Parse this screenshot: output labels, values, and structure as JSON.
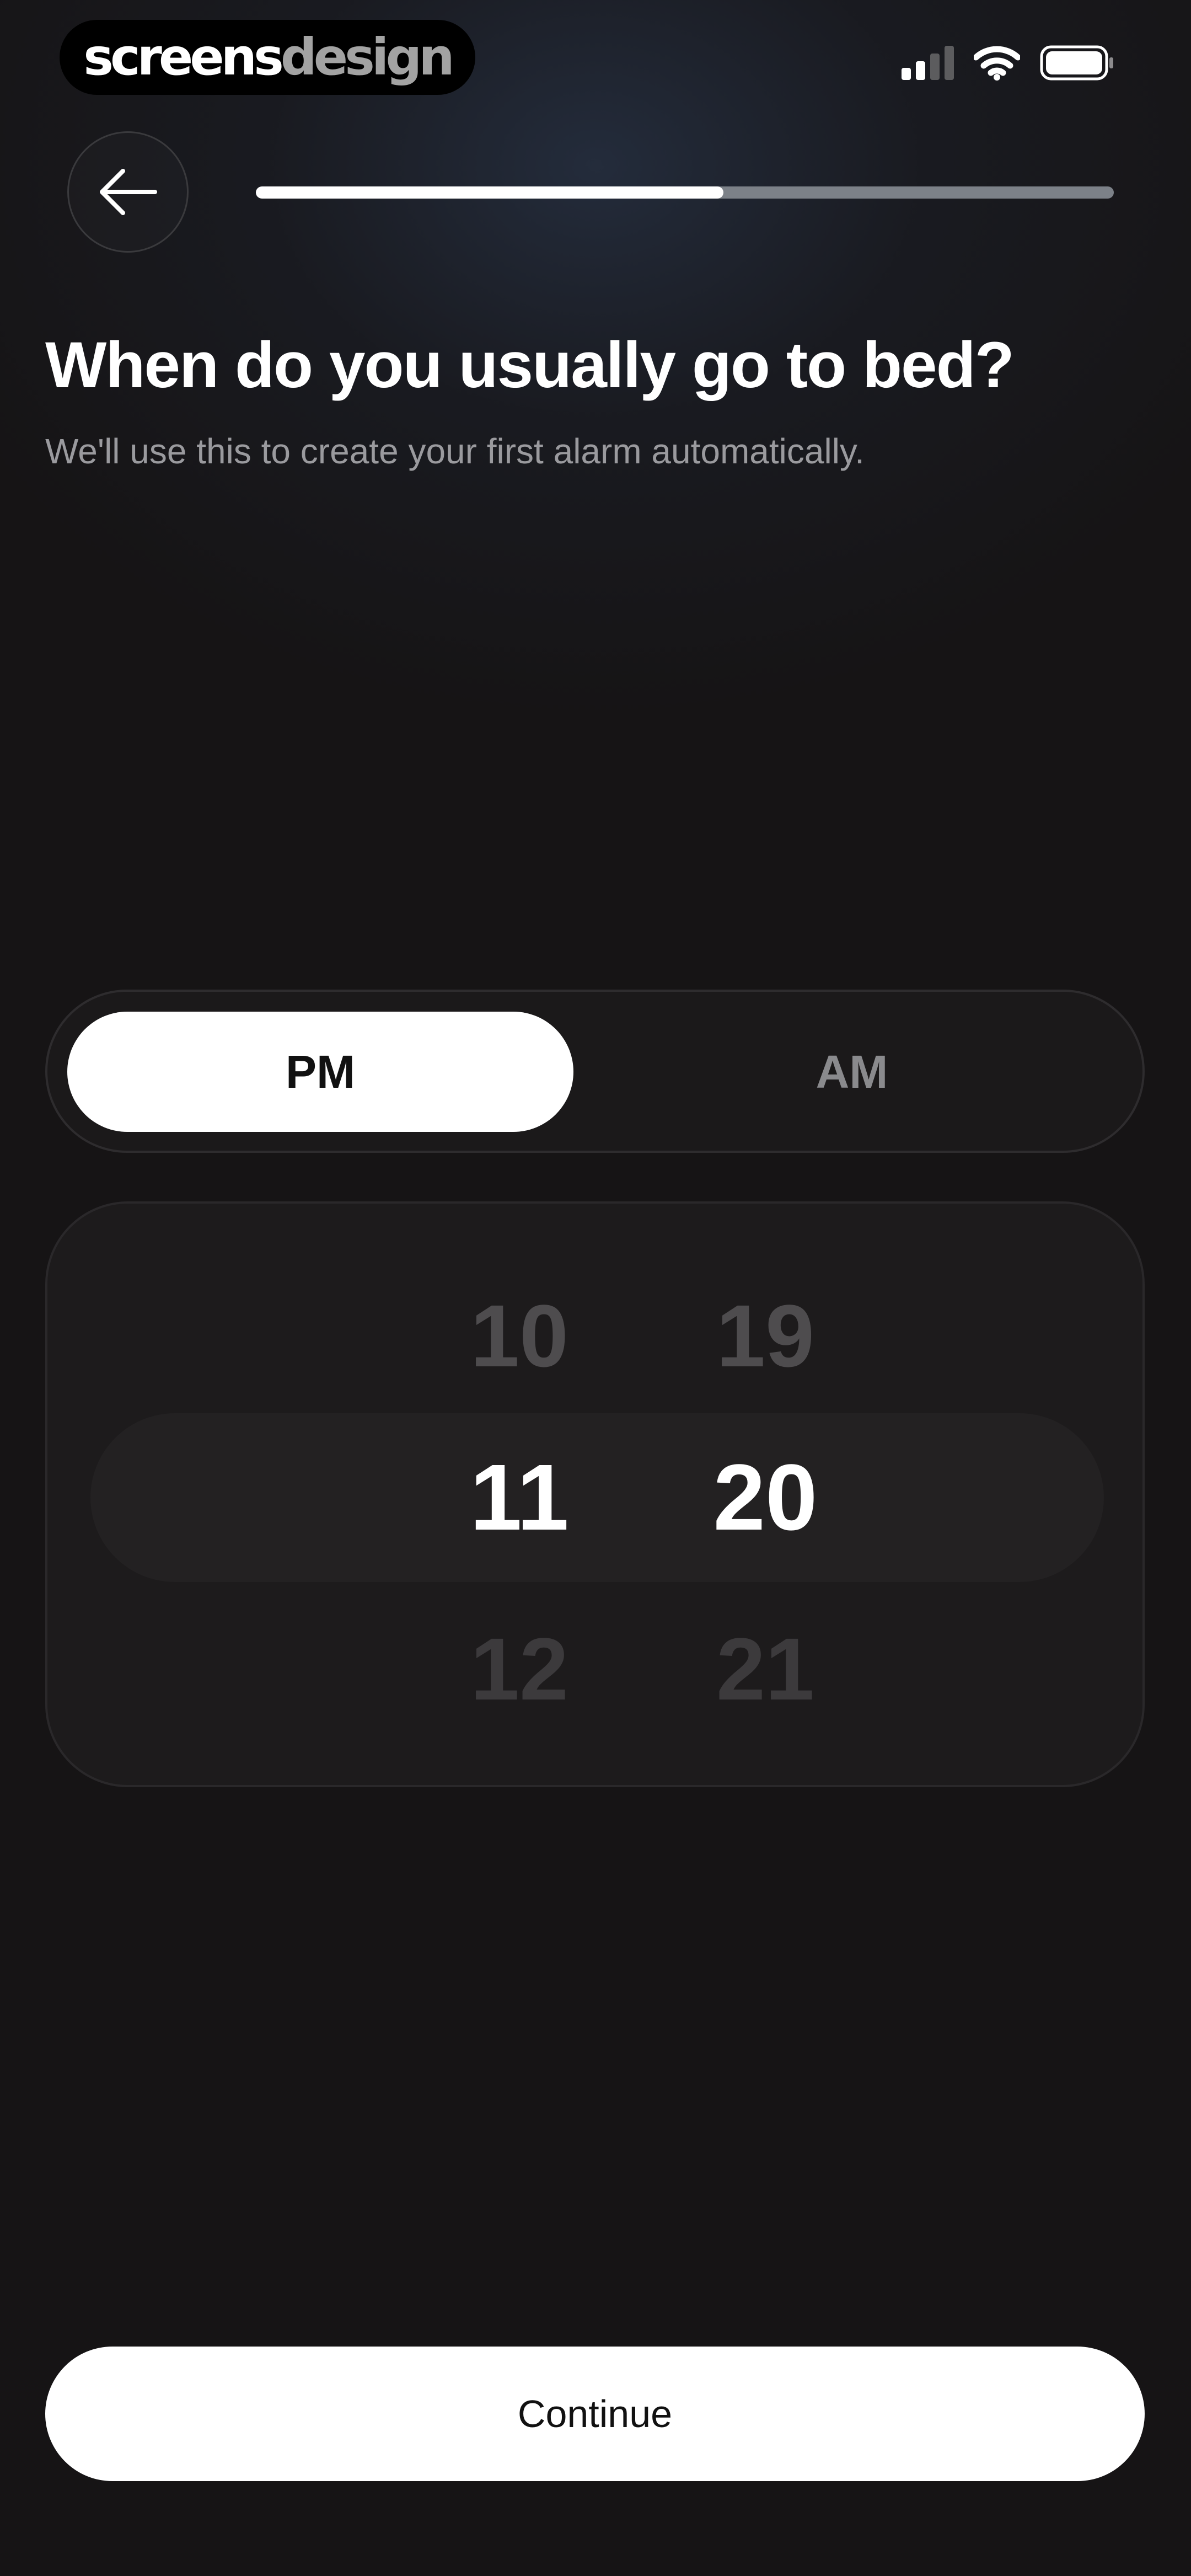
{
  "status_bar": {
    "brand_part1": "screens",
    "brand_part2": "design",
    "signal_icon": "cellular-signal-icon",
    "wifi_icon": "wifi-icon",
    "battery_icon": "battery-icon"
  },
  "header": {
    "back_icon": "arrow-left-icon",
    "progress": 0.545
  },
  "question": {
    "title": "When do you usually go to bed?",
    "subtitle": "We'll use this to create your first alarm automatically."
  },
  "period_toggle": {
    "options": [
      "PM",
      "AM"
    ],
    "selected": "PM"
  },
  "time_picker": {
    "hours": {
      "prev": "10",
      "current": "11",
      "next": "12"
    },
    "minutes": {
      "prev": "19",
      "current": "20",
      "next": "21"
    }
  },
  "footer": {
    "continue_label": "Continue"
  },
  "colors": {
    "background": "#161415",
    "accent": "#ffffff",
    "muted_text": "#9a9a9e",
    "progress_track": "#7c8188"
  }
}
